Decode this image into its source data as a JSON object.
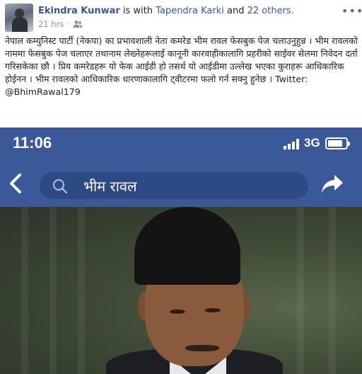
{
  "post": {
    "author": "Ekindra Kunwar",
    "with_text": " is with ",
    "tagged_first": "Tapendra Karki",
    "and_text": " and ",
    "tagged_others": "22 others.",
    "time": "21 hrs",
    "separator": "·",
    "privacy_icon": "friends-icon",
    "more_label": "•••",
    "body": "नेपाल कम्युनिस्ट पार्टी (नेकपा) का प्रभावशाली नेता कमरेड भीम रावल फेसबुक पेज चलाउनुहुन्न । भीम रावलको नाममा फेसबुक पेज चलाएर तथानाम लेख्नेहरूलाई कानूनी कारवाहीकालागि प्रहरीको साईवर सेलमा निवेदन दर्ता गरिसकेका छौ । प्रिय कमरेडहरू यो फेक आईडी हो तसर्थ यो आईडीमा उल्लेख भएका कुराहरू आधिकारिक होईनन । भीम रावलको आधिकारिक धारणाकालागि ट्वीटरमा फलो गर्न सक्नु हुनेछ । Twitter: ",
    "twitter_handle": "@BhimRawal179"
  },
  "screenshot": {
    "time": "11:06",
    "network": "3G",
    "battery_level": 0.85,
    "search_query": "भीम रावल",
    "colors": {
      "facebook_blue": "#3b5998",
      "search_bg": "#2e4a84"
    }
  }
}
